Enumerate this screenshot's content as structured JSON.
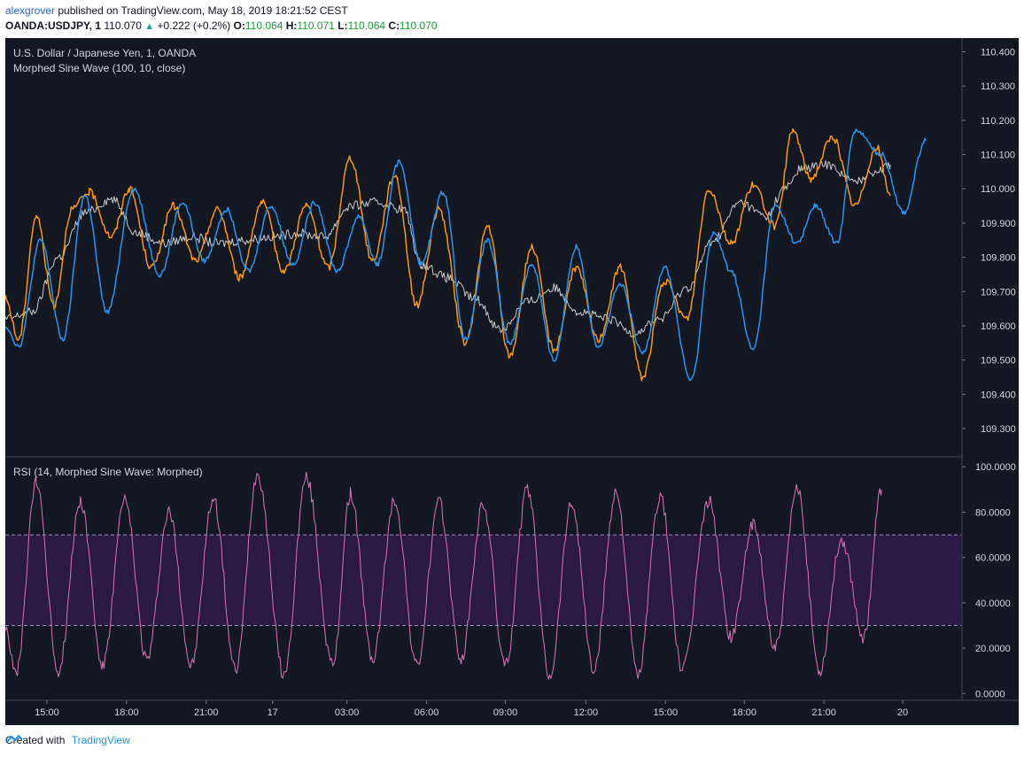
{
  "header": {
    "author": "alexgrover",
    "published_text": "published on TradingView.com, May 18, 2019 18:21:52 CEST",
    "symbol": "OANDA:USDJPY, 1",
    "last": "110.070",
    "change": "+0.222 (+0.2%)",
    "o_label": "O:",
    "o_value": "110.064",
    "h_label": "H:",
    "h_value": "110.071",
    "l_label": "L:",
    "l_value": "110.064",
    "c_label": "C:",
    "c_value": "110.070"
  },
  "footer": {
    "created_with": "Created with",
    "brand": "TradingView"
  },
  "colors": {
    "background": "#131722",
    "price": "#c9c9c9",
    "morphed": "#ff9800",
    "sine": "#2196f3",
    "rsi": "#d873b4",
    "rsi_band": "#2a1a44"
  },
  "chart_data": [
    {
      "type": "line",
      "title": "U.S. Dollar / Japanese Yen, 1, OANDA",
      "subtitle": "Morphed Sine Wave (100, 10, close)",
      "ylim": [
        109.22,
        110.44
      ],
      "y_ticks": [
        "110.400",
        "110.300",
        "110.200",
        "110.100",
        "110.000",
        "109.900",
        "109.800",
        "109.700",
        "109.600",
        "109.500",
        "109.400",
        "109.300"
      ],
      "x_ticks": [
        "15:00",
        "18:00",
        "21:00",
        "17",
        "03:00",
        "06:00",
        "09:00",
        "12:00",
        "15:00",
        "18:00",
        "21:00",
        "20"
      ],
      "x_tick_index": [
        47,
        137,
        227,
        302,
        386,
        476,
        565,
        656,
        746,
        835,
        925,
        1014
      ],
      "xlim": [
        0,
        1080
      ],
      "series": [
        {
          "key": "price",
          "x": [
            0,
            30,
            60,
            90,
            120,
            150,
            180,
            210,
            240,
            270,
            300,
            330,
            360,
            390,
            420,
            450,
            470,
            500,
            530,
            560,
            590,
            620,
            650,
            680,
            710,
            740,
            770,
            800,
            830,
            860,
            880,
            900,
            930,
            960,
            980,
            1000
          ],
          "values": [
            109.62,
            109.64,
            109.8,
            109.93,
            109.97,
            109.87,
            109.84,
            109.86,
            109.84,
            109.85,
            109.86,
            109.87,
            109.86,
            109.95,
            109.96,
            109.94,
            109.78,
            109.74,
            109.68,
            109.59,
            109.67,
            109.71,
            109.64,
            109.62,
            109.58,
            109.62,
            109.71,
            109.85,
            109.96,
            109.92,
            110.0,
            110.06,
            110.07,
            110.02,
            110.05,
            110.07
          ]
        },
        {
          "key": "morphed",
          "x": [
            0,
            15,
            35,
            55,
            75,
            95,
            120,
            140,
            165,
            190,
            215,
            240,
            265,
            290,
            315,
            340,
            365,
            390,
            415,
            440,
            465,
            490,
            520,
            545,
            570,
            595,
            620,
            645,
            670,
            695,
            720,
            745,
            770,
            795,
            820,
            845,
            870,
            890,
            910,
            935,
            960,
            985,
            1000
          ],
          "values": [
            109.68,
            109.56,
            109.92,
            109.66,
            109.94,
            109.99,
            109.86,
            110.0,
            109.77,
            109.95,
            109.79,
            109.94,
            109.74,
            109.96,
            109.76,
            109.95,
            109.77,
            110.09,
            109.79,
            110.04,
            109.66,
            109.94,
            109.55,
            109.89,
            109.51,
            109.83,
            109.53,
            109.77,
            109.56,
            109.77,
            109.45,
            109.73,
            109.62,
            110.0,
            109.84,
            110.01,
            109.89,
            110.17,
            110.03,
            110.15,
            109.95,
            110.12,
            109.98
          ]
        },
        {
          "key": "sine",
          "x": [
            0,
            15,
            40,
            65,
            90,
            115,
            145,
            175,
            200,
            225,
            250,
            275,
            300,
            325,
            350,
            375,
            400,
            420,
            445,
            470,
            495,
            520,
            545,
            570,
            595,
            620,
            645,
            670,
            695,
            720,
            745,
            775,
            800,
            820,
            845,
            870,
            895,
            915,
            940,
            960,
            990,
            1015,
            1040
          ],
          "values": [
            109.6,
            109.54,
            109.85,
            109.56,
            109.98,
            109.64,
            110.0,
            109.75,
            109.96,
            109.79,
            109.94,
            109.76,
            109.95,
            109.78,
            109.96,
            109.76,
            109.92,
            109.78,
            110.08,
            109.78,
            109.99,
            109.56,
            109.85,
            109.55,
            109.78,
            109.5,
            109.83,
            109.54,
            109.72,
            109.52,
            109.77,
            109.44,
            109.87,
            109.76,
            109.53,
            109.95,
            109.84,
            109.95,
            109.84,
            110.17,
            110.1,
            109.93,
            110.14
          ]
        }
      ]
    },
    {
      "type": "line",
      "title": "RSI (14, Morphed Sine Wave: Morphed)",
      "ylim": [
        -3,
        104
      ],
      "y_ticks": [
        "100.0000",
        "80.0000",
        "60.0000",
        "40.0000",
        "20.0000",
        "0.0000"
      ],
      "bands": [
        70,
        30
      ],
      "series": [
        {
          "key": "rsi",
          "x": [
            0,
            12,
            35,
            60,
            85,
            110,
            135,
            160,
            185,
            210,
            235,
            260,
            285,
            315,
            340,
            370,
            390,
            415,
            440,
            465,
            490,
            515,
            540,
            565,
            590,
            615,
            640,
            665,
            690,
            715,
            740,
            765,
            795,
            820,
            845,
            870,
            895,
            920,
            945,
            970,
            990
          ],
          "values": [
            30,
            8,
            93,
            10,
            85,
            12,
            85,
            15,
            80,
            12,
            86,
            10,
            97,
            8,
            95,
            12,
            88,
            15,
            85,
            12,
            84,
            15,
            83,
            12,
            90,
            8,
            84,
            10,
            89,
            8,
            87,
            10,
            85,
            25,
            74,
            20,
            90,
            10,
            68,
            25,
            90
          ]
        }
      ]
    }
  ]
}
